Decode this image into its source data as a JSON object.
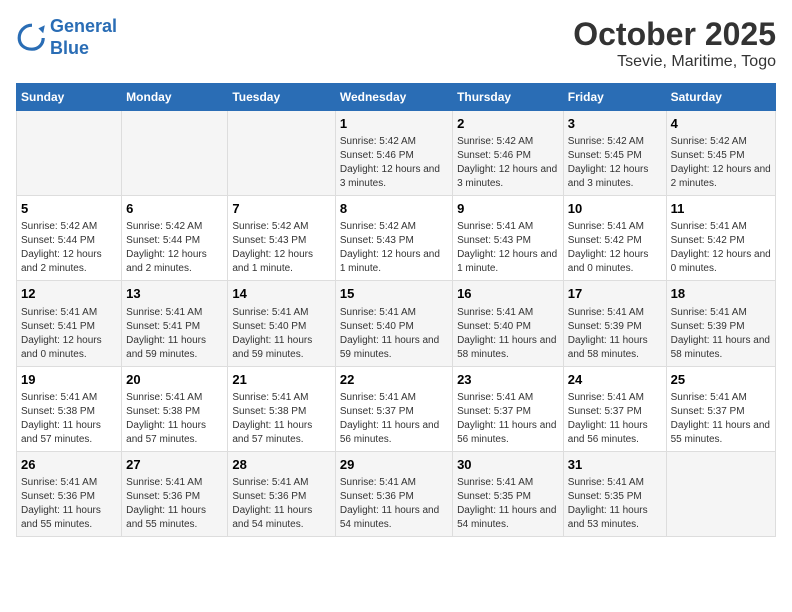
{
  "header": {
    "logo_line1": "General",
    "logo_line2": "Blue",
    "title": "October 2025",
    "subtitle": "Tsevie, Maritime, Togo"
  },
  "calendar": {
    "days_of_week": [
      "Sunday",
      "Monday",
      "Tuesday",
      "Wednesday",
      "Thursday",
      "Friday",
      "Saturday"
    ],
    "weeks": [
      [
        {
          "day": "",
          "info": ""
        },
        {
          "day": "",
          "info": ""
        },
        {
          "day": "",
          "info": ""
        },
        {
          "day": "1",
          "info": "Sunrise: 5:42 AM\nSunset: 5:46 PM\nDaylight: 12 hours and 3 minutes."
        },
        {
          "day": "2",
          "info": "Sunrise: 5:42 AM\nSunset: 5:46 PM\nDaylight: 12 hours and 3 minutes."
        },
        {
          "day": "3",
          "info": "Sunrise: 5:42 AM\nSunset: 5:45 PM\nDaylight: 12 hours and 3 minutes."
        },
        {
          "day": "4",
          "info": "Sunrise: 5:42 AM\nSunset: 5:45 PM\nDaylight: 12 hours and 2 minutes."
        }
      ],
      [
        {
          "day": "5",
          "info": "Sunrise: 5:42 AM\nSunset: 5:44 PM\nDaylight: 12 hours and 2 minutes."
        },
        {
          "day": "6",
          "info": "Sunrise: 5:42 AM\nSunset: 5:44 PM\nDaylight: 12 hours and 2 minutes."
        },
        {
          "day": "7",
          "info": "Sunrise: 5:42 AM\nSunset: 5:43 PM\nDaylight: 12 hours and 1 minute."
        },
        {
          "day": "8",
          "info": "Sunrise: 5:42 AM\nSunset: 5:43 PM\nDaylight: 12 hours and 1 minute."
        },
        {
          "day": "9",
          "info": "Sunrise: 5:41 AM\nSunset: 5:43 PM\nDaylight: 12 hours and 1 minute."
        },
        {
          "day": "10",
          "info": "Sunrise: 5:41 AM\nSunset: 5:42 PM\nDaylight: 12 hours and 0 minutes."
        },
        {
          "day": "11",
          "info": "Sunrise: 5:41 AM\nSunset: 5:42 PM\nDaylight: 12 hours and 0 minutes."
        }
      ],
      [
        {
          "day": "12",
          "info": "Sunrise: 5:41 AM\nSunset: 5:41 PM\nDaylight: 12 hours and 0 minutes."
        },
        {
          "day": "13",
          "info": "Sunrise: 5:41 AM\nSunset: 5:41 PM\nDaylight: 11 hours and 59 minutes."
        },
        {
          "day": "14",
          "info": "Sunrise: 5:41 AM\nSunset: 5:40 PM\nDaylight: 11 hours and 59 minutes."
        },
        {
          "day": "15",
          "info": "Sunrise: 5:41 AM\nSunset: 5:40 PM\nDaylight: 11 hours and 59 minutes."
        },
        {
          "day": "16",
          "info": "Sunrise: 5:41 AM\nSunset: 5:40 PM\nDaylight: 11 hours and 58 minutes."
        },
        {
          "day": "17",
          "info": "Sunrise: 5:41 AM\nSunset: 5:39 PM\nDaylight: 11 hours and 58 minutes."
        },
        {
          "day": "18",
          "info": "Sunrise: 5:41 AM\nSunset: 5:39 PM\nDaylight: 11 hours and 58 minutes."
        }
      ],
      [
        {
          "day": "19",
          "info": "Sunrise: 5:41 AM\nSunset: 5:38 PM\nDaylight: 11 hours and 57 minutes."
        },
        {
          "day": "20",
          "info": "Sunrise: 5:41 AM\nSunset: 5:38 PM\nDaylight: 11 hours and 57 minutes."
        },
        {
          "day": "21",
          "info": "Sunrise: 5:41 AM\nSunset: 5:38 PM\nDaylight: 11 hours and 57 minutes."
        },
        {
          "day": "22",
          "info": "Sunrise: 5:41 AM\nSunset: 5:37 PM\nDaylight: 11 hours and 56 minutes."
        },
        {
          "day": "23",
          "info": "Sunrise: 5:41 AM\nSunset: 5:37 PM\nDaylight: 11 hours and 56 minutes."
        },
        {
          "day": "24",
          "info": "Sunrise: 5:41 AM\nSunset: 5:37 PM\nDaylight: 11 hours and 56 minutes."
        },
        {
          "day": "25",
          "info": "Sunrise: 5:41 AM\nSunset: 5:37 PM\nDaylight: 11 hours and 55 minutes."
        }
      ],
      [
        {
          "day": "26",
          "info": "Sunrise: 5:41 AM\nSunset: 5:36 PM\nDaylight: 11 hours and 55 minutes."
        },
        {
          "day": "27",
          "info": "Sunrise: 5:41 AM\nSunset: 5:36 PM\nDaylight: 11 hours and 55 minutes."
        },
        {
          "day": "28",
          "info": "Sunrise: 5:41 AM\nSunset: 5:36 PM\nDaylight: 11 hours and 54 minutes."
        },
        {
          "day": "29",
          "info": "Sunrise: 5:41 AM\nSunset: 5:36 PM\nDaylight: 11 hours and 54 minutes."
        },
        {
          "day": "30",
          "info": "Sunrise: 5:41 AM\nSunset: 5:35 PM\nDaylight: 11 hours and 54 minutes."
        },
        {
          "day": "31",
          "info": "Sunrise: 5:41 AM\nSunset: 5:35 PM\nDaylight: 11 hours and 53 minutes."
        },
        {
          "day": "",
          "info": ""
        }
      ]
    ]
  }
}
